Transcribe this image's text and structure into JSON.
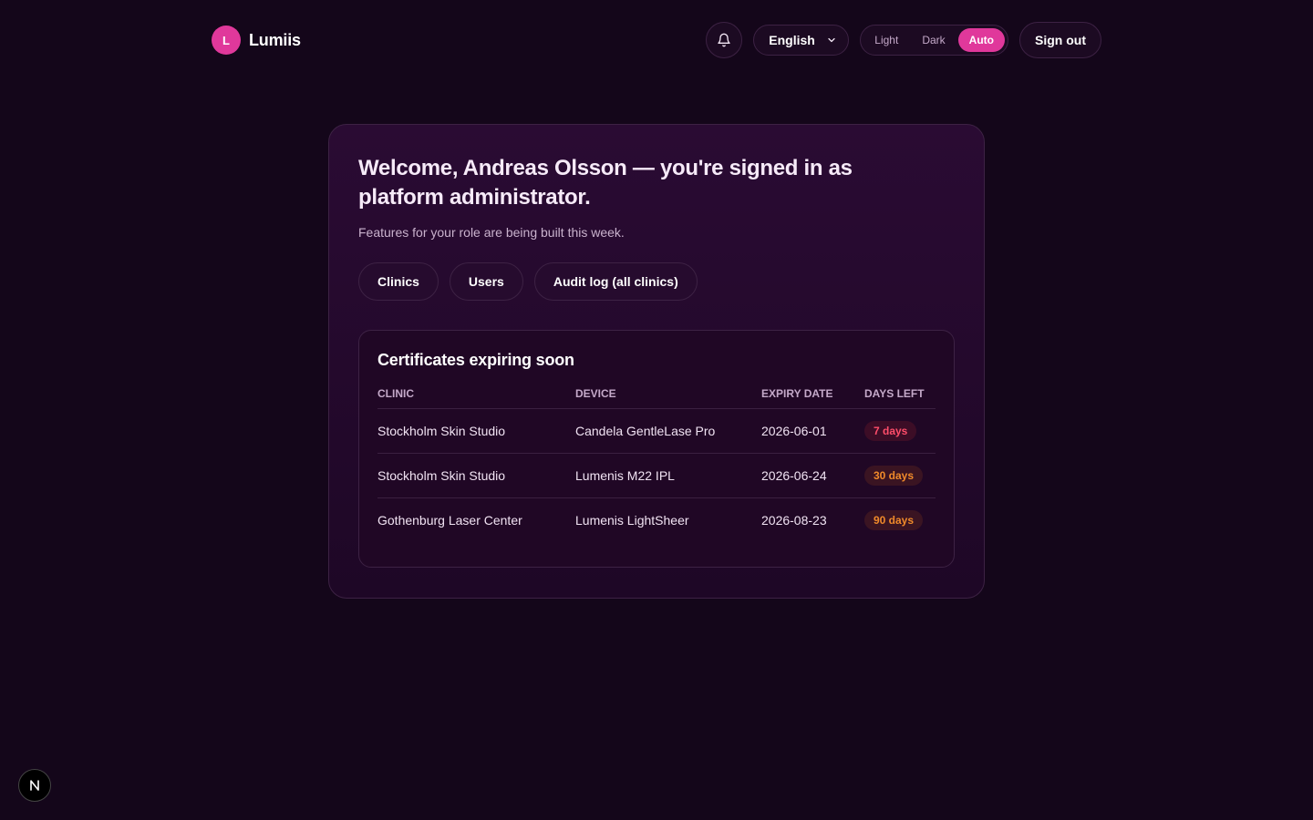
{
  "header": {
    "logo_letter": "L",
    "brand": "Lumiis",
    "language": "English",
    "theme_options": [
      "Light",
      "Dark",
      "Auto"
    ],
    "theme_selected": "Auto",
    "sign_out": "Sign out"
  },
  "main": {
    "welcome": "Welcome, Andreas Olsson — you're signed in as platform administrator.",
    "subtitle": "Features for your role are being built this week.",
    "nav": [
      "Clinics",
      "Users",
      "Audit log (all clinics)"
    ]
  },
  "certificates": {
    "title": "Certificates expiring soon",
    "columns": [
      "Clinic",
      "Device",
      "Expiry date",
      "Days left"
    ],
    "rows": [
      {
        "clinic": "Stockholm Skin Studio",
        "device": "Candela GentleLase Pro",
        "expiry": "2026-06-01",
        "days_left": "7 days",
        "status_color": "#ff4d6a"
      },
      {
        "clinic": "Stockholm Skin Studio",
        "device": "Lumenis M22 IPL",
        "expiry": "2026-06-24",
        "days_left": "30 days",
        "status_color": "#f08a2a"
      },
      {
        "clinic": "Gothenburg Laser Center",
        "device": "Lumenis LightSheer",
        "expiry": "2026-08-23",
        "days_left": "90 days",
        "status_color": "#f08a2a"
      }
    ]
  },
  "colors": {
    "accent": "#e0389b",
    "background": "#14061a"
  },
  "dev_badge": {
    "letter": "N"
  }
}
